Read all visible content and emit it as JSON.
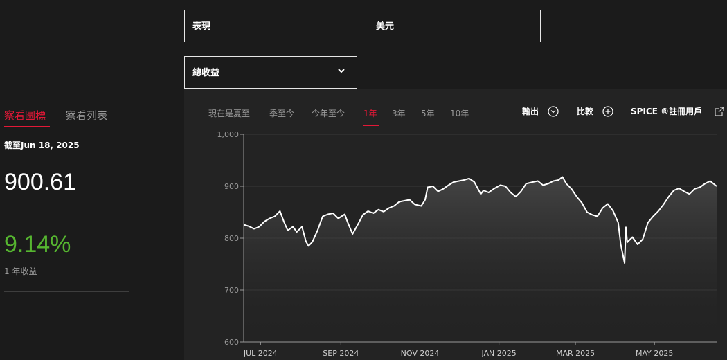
{
  "filters": {
    "metric": "表現",
    "currency": "美元",
    "return_type": "總收益"
  },
  "side": {
    "tab_chart": "察看圖標",
    "tab_list": "察看列表",
    "as_of": "截至Jun 18, 2025",
    "price": "900.61",
    "return_value": "9.14%",
    "return_label": "1 年收益"
  },
  "ranges": [
    "現在是夏至",
    "季至今",
    "今年至今",
    "1年",
    "3年",
    "5年",
    "10年"
  ],
  "active_range": "1年",
  "tools": {
    "export": "輸出",
    "compare": "比較",
    "spice": "SPICE ®註冊用戶"
  },
  "colors": {
    "accent": "#e31837",
    "positive": "#56b630",
    "background": "#1b1b1b",
    "chart_bg": "#232323"
  },
  "chart_data": {
    "type": "area",
    "title": "",
    "xlabel": "",
    "ylabel": "",
    "ylim": [
      600,
      1000
    ],
    "yticks": [
      "600",
      "700",
      "800",
      "900",
      "1,000"
    ],
    "grid": true,
    "x_tick_labels": [
      "JUL 2024",
      "SEP 2024",
      "NOV 2024",
      "JAN 2025",
      "MAR 2025",
      "MAY 2025"
    ],
    "x_ticks": [
      "2024-07-01",
      "2024-09-01",
      "2024-11-01",
      "2025-01-01",
      "2025-03-01",
      "2025-05-01"
    ],
    "x_range": [
      "2024-06-18",
      "2025-06-18"
    ],
    "series": [
      {
        "x": [
          "2024-06-18",
          "2024-06-22",
          "2024-06-26",
          "2024-06-30",
          "2024-07-04",
          "2024-07-08",
          "2024-07-12",
          "2024-07-16",
          "2024-07-19",
          "2024-07-22",
          "2024-07-26",
          "2024-07-29",
          "2024-08-02",
          "2024-08-05",
          "2024-08-07",
          "2024-08-10",
          "2024-08-14",
          "2024-08-18",
          "2024-08-22",
          "2024-08-26",
          "2024-08-30",
          "2024-09-04",
          "2024-09-06",
          "2024-09-10",
          "2024-09-14",
          "2024-09-18",
          "2024-09-22",
          "2024-09-26",
          "2024-09-30",
          "2024-10-04",
          "2024-10-08",
          "2024-10-12",
          "2024-10-16",
          "2024-10-20",
          "2024-10-24",
          "2024-10-28",
          "2024-11-02",
          "2024-11-05",
          "2024-11-07",
          "2024-11-11",
          "2024-11-15",
          "2024-11-19",
          "2024-11-23",
          "2024-11-27",
          "2024-12-01",
          "2024-12-05",
          "2024-12-09",
          "2024-12-13",
          "2024-12-18",
          "2024-12-20",
          "2024-12-24",
          "2024-12-28",
          "2025-01-02",
          "2025-01-06",
          "2025-01-10",
          "2025-01-14",
          "2025-01-18",
          "2025-01-22",
          "2025-01-27",
          "2025-01-31",
          "2025-02-04",
          "2025-02-08",
          "2025-02-12",
          "2025-02-16",
          "2025-02-19",
          "2025-02-22",
          "2025-02-26",
          "2025-03-02",
          "2025-03-06",
          "2025-03-10",
          "2025-03-14",
          "2025-03-18",
          "2025-03-22",
          "2025-03-26",
          "2025-03-30",
          "2025-04-03",
          "2025-04-05",
          "2025-04-08",
          "2025-04-09",
          "2025-04-10",
          "2025-04-14",
          "2025-04-18",
          "2025-04-22",
          "2025-04-26",
          "2025-04-30",
          "2025-05-04",
          "2025-05-08",
          "2025-05-12",
          "2025-05-16",
          "2025-05-20",
          "2025-05-24",
          "2025-05-28",
          "2025-06-01",
          "2025-06-05",
          "2025-06-09",
          "2025-06-13",
          "2025-06-18"
        ],
        "y": [
          826,
          823,
          818,
          822,
          832,
          838,
          842,
          852,
          832,
          815,
          822,
          812,
          822,
          794,
          785,
          793,
          815,
          842,
          846,
          848,
          838,
          846,
          832,
          808,
          826,
          845,
          852,
          848,
          855,
          851,
          858,
          862,
          870,
          872,
          874,
          865,
          862,
          874,
          898,
          900,
          890,
          895,
          902,
          908,
          910,
          912,
          915,
          908,
          885,
          892,
          888,
          895,
          902,
          900,
          888,
          880,
          890,
          905,
          908,
          910,
          902,
          905,
          910,
          912,
          918,
          905,
          895,
          880,
          868,
          850,
          845,
          842,
          858,
          866,
          853,
          830,
          788,
          752,
          821,
          792,
          802,
          788,
          798,
          830,
          842,
          852,
          865,
          880,
          892,
          896,
          890,
          885,
          895,
          898,
          905,
          910,
          900
        ]
      }
    ]
  }
}
